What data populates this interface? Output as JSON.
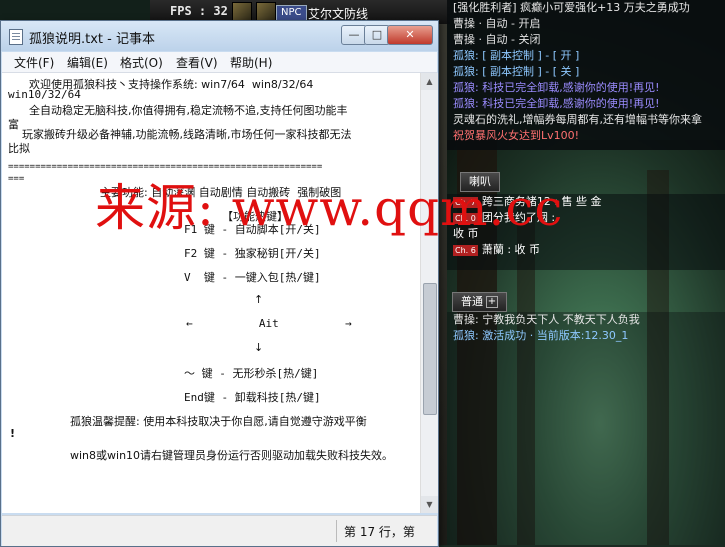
{
  "game": {
    "fps": "FPS : 32",
    "npc_badge": "NPC",
    "npc_name": "艾尔文防线",
    "chat_top": [
      {
        "text": "[强化胜利者] 疯癫小可爱强化+13 万夫之勇成功",
        "color": "#e6e6e6"
      },
      {
        "text": "曹操 · 自动 - 开启",
        "color": "#e6e6e6"
      },
      {
        "text": "曹操 · 自动 - 关闭",
        "color": "#e6e6e6"
      },
      {
        "text": "孤狼: [ 副本控制 ] - [ 开 ]",
        "color": "#8ec8ff"
      },
      {
        "text": "孤狼: [ 副本控制 ] - [ 关 ]",
        "color": "#8ec8ff"
      },
      {
        "text": "孤狼: 科技已完全卸载,感谢你的使用!再见!",
        "color": "#9b8cff"
      },
      {
        "text": "孤狼: 科技已完全卸载,感谢你的使用!再见!",
        "color": "#9b8cff"
      },
      {
        "text": "灵魂石的洗礼,增幅券每周都有,还有增幅书等你来拿",
        "color": "#e6e6e6"
      },
      {
        "text": "祝贺暴风火女达到Lv100!",
        "color": "#ff7070"
      }
    ],
    "tab_horn": "喇叭",
    "chat_mid": [
      {
        "badge": "Ch. 7",
        "text": "跨三商务褚12 : 售  些    金",
        "color": "#ffffff"
      },
      {
        "badge": "Ch. 0",
        "text": "团分我约了烟 :",
        "color": "#ffffff"
      },
      {
        "badge": "",
        "text": "              收    币",
        "color": "#ffffff"
      },
      {
        "badge": "Ch. 6",
        "text": "萧蘭 : 收  币",
        "color": "#ffffff"
      }
    ],
    "tab_normal": "普通",
    "tab_normal_plus": "+",
    "chat_bottom": [
      {
        "text": "曹操: 宁教我负天下人 不教天下人负我",
        "color": "#e6e6e6"
      },
      {
        "text": "孤狼: 激活成功 · 当前版本:12.30_1",
        "color": "#8ec8ff"
      }
    ]
  },
  "notepad": {
    "title": "孤狼说明.txt - 记事本",
    "window_buttons": {
      "minimize": "—",
      "maximize": "□",
      "close": "✕"
    },
    "menu": [
      "文件(F)",
      "编辑(E)",
      "格式(O)",
      "查看(V)",
      "帮助(H)"
    ],
    "lines": [
      "      欢迎使用孤狼科技丶支持操作系统: win7/64  win8/32/64",
      "win10/32/64",
      "      全自动稳定无脑科技,你值得拥有,稳定流畅不追,支持任何图功能丰",
      "富",
      "    玩家搬砖升级必备神辅,功能流畅,线路清晰,市场任何一家科技都无法",
      "比拟",
      "==========================================================",
      "===",
      "主要功能: 自动深渊 自动剧情 自动搬砖  强制破图",
      "【功能热键】",
      "F1 键 - 自动脚本[开/关]",
      "F2 键 - 独家秘钥[开/关]",
      "V  键 - 一键入包[热/键]",
      "↑",
      "←          Ait          →",
      "↓",
      "～ 键 - 无形秒杀[热/键]",
      "End键 - 卸载科技[热/键]",
      "孤狼温馨提醒: 使用本科技取决于你自愿,请自觉遵守游戏平衡",
      "!",
      "win8或win10请右键管理员身份运行否则驱动加载失败科技失效。"
    ],
    "watermark": "来源: www.qqm.cc",
    "status": "第 17 行，第"
  }
}
